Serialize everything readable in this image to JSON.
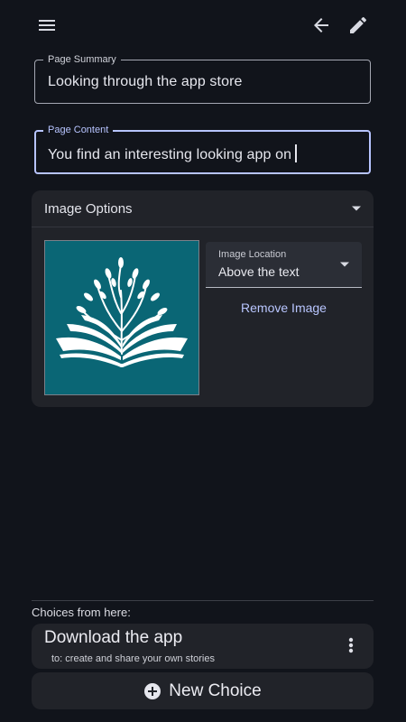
{
  "topbar": {
    "menu_icon": "hamburger-menu-icon",
    "back_icon": "arrow-back-icon",
    "edit_icon": "pencil-icon"
  },
  "form": {
    "summary": {
      "label": "Page Summary",
      "value": "Looking through the app store"
    },
    "content": {
      "label": "Page Content",
      "value": "You find an interesting looking app on"
    }
  },
  "image_options": {
    "title": "Image Options",
    "image_icon": "open-book-tree-icon",
    "location": {
      "label": "Image Location",
      "value": "Above the text"
    },
    "remove_label": "Remove Image"
  },
  "choices": {
    "label": "Choices from here:",
    "items": [
      {
        "title": "Download the app",
        "subtitle": "to: create and share your own stories"
      }
    ],
    "new_choice_label": "New Choice"
  },
  "colors": {
    "background": "#11141b",
    "card": "#212329",
    "accent": "#b7c4ff",
    "image_bg": "#0a6675"
  }
}
